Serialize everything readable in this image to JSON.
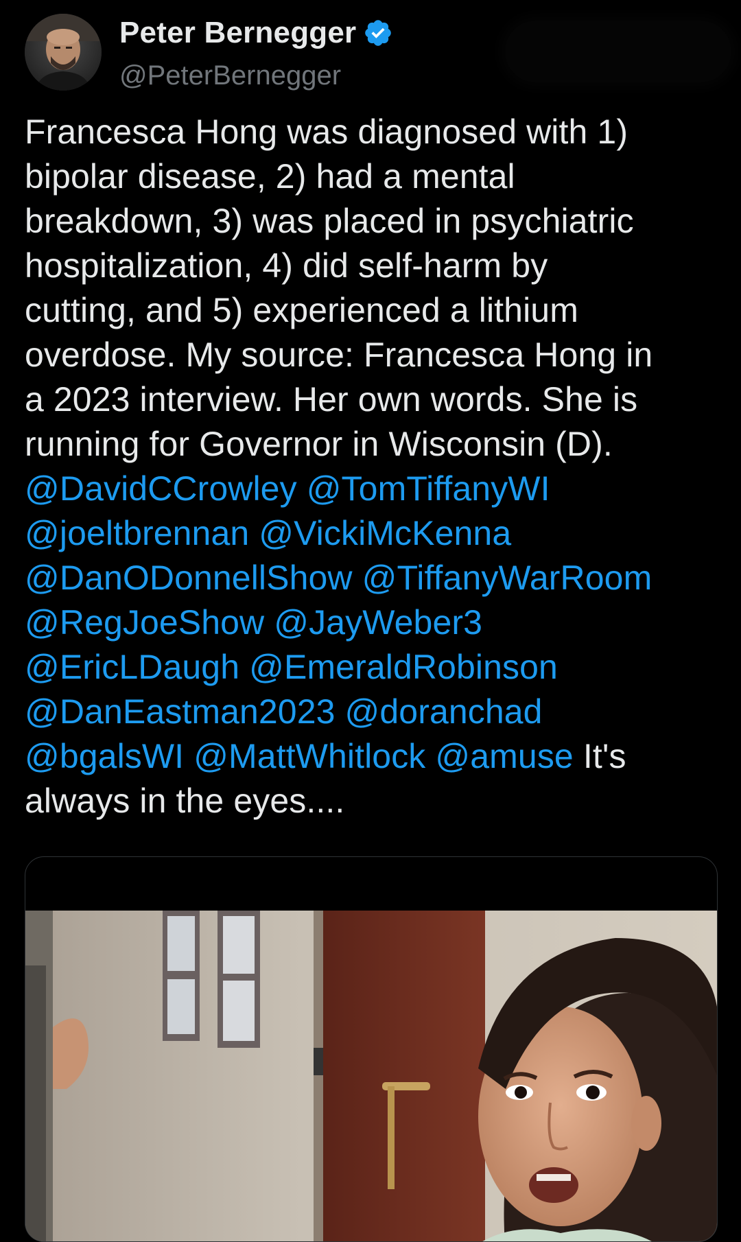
{
  "author": {
    "display_name": "Peter Bernegger",
    "handle": "@PeterBernegger",
    "verified": true,
    "avatar_icon": "profile-photo",
    "verified_icon": "verified-badge-icon"
  },
  "tweet": {
    "lines": [
      [
        {
          "text": "Francesca Hong was diagnosed with 1)",
          "type": "text"
        }
      ],
      [
        {
          "text": "bipolar disease, 2) had a mental",
          "type": "text"
        }
      ],
      [
        {
          "text": "breakdown, 3) was placed in psychiatric",
          "type": "text"
        }
      ],
      [
        {
          "text": "hospitalization, 4) did self-harm by",
          "type": "text"
        }
      ],
      [
        {
          "text": "cutting, and 5)  experienced a lithium",
          "type": "text"
        }
      ],
      [
        {
          "text": "overdose. My source: Francesca Hong in",
          "type": "text"
        }
      ],
      [
        {
          "text": "a 2023 interview. Her own words. She is",
          "type": "text"
        }
      ],
      [
        {
          "text": "running for Governor in Wisconsin (D).",
          "type": "text"
        }
      ],
      [
        {
          "text": "@DavidCCrowley",
          "type": "mention"
        },
        {
          "text": " ",
          "type": "text"
        },
        {
          "text": "@TomTiffanyWI",
          "type": "mention"
        }
      ],
      [
        {
          "text": "@joeltbrennan",
          "type": "mention"
        },
        {
          "text": " ",
          "type": "text"
        },
        {
          "text": "@VickiMcKenna",
          "type": "mention"
        }
      ],
      [
        {
          "text": "@DanODonnellShow",
          "type": "mention"
        },
        {
          "text": " ",
          "type": "text"
        },
        {
          "text": "@TiffanyWarRoom",
          "type": "mention"
        }
      ],
      [
        {
          "text": "@RegJoeShow",
          "type": "mention"
        },
        {
          "text": " ",
          "type": "text"
        },
        {
          "text": "@JayWeber3",
          "type": "mention"
        }
      ],
      [
        {
          "text": "@EricLDaugh",
          "type": "mention"
        },
        {
          "text": " ",
          "type": "text"
        },
        {
          "text": "@EmeraldRobinson",
          "type": "mention"
        }
      ],
      [
        {
          "text": "@DanEastman2023",
          "type": "mention"
        },
        {
          "text": " ",
          "type": "text"
        },
        {
          "text": "@doranchad",
          "type": "mention"
        }
      ],
      [
        {
          "text": "@bgalsWI",
          "type": "mention"
        },
        {
          "text": " ",
          "type": "text"
        },
        {
          "text": "@MattWhitlock",
          "type": "mention"
        },
        {
          "text": " ",
          "type": "text"
        },
        {
          "text": "@amuse",
          "type": "mention"
        },
        {
          "text": " It's",
          "type": "text"
        }
      ],
      [
        {
          "text": "always in the eyes....",
          "type": "text"
        }
      ]
    ]
  },
  "media": {
    "kind": "video-still",
    "icon": "media-photo"
  },
  "colors": {
    "background": "#000000",
    "text": "#e7e9ea",
    "secondary": "#71767b",
    "mention": "#1d9bf0",
    "verified": "#1d9bf0",
    "card_border": "#2f3336"
  }
}
